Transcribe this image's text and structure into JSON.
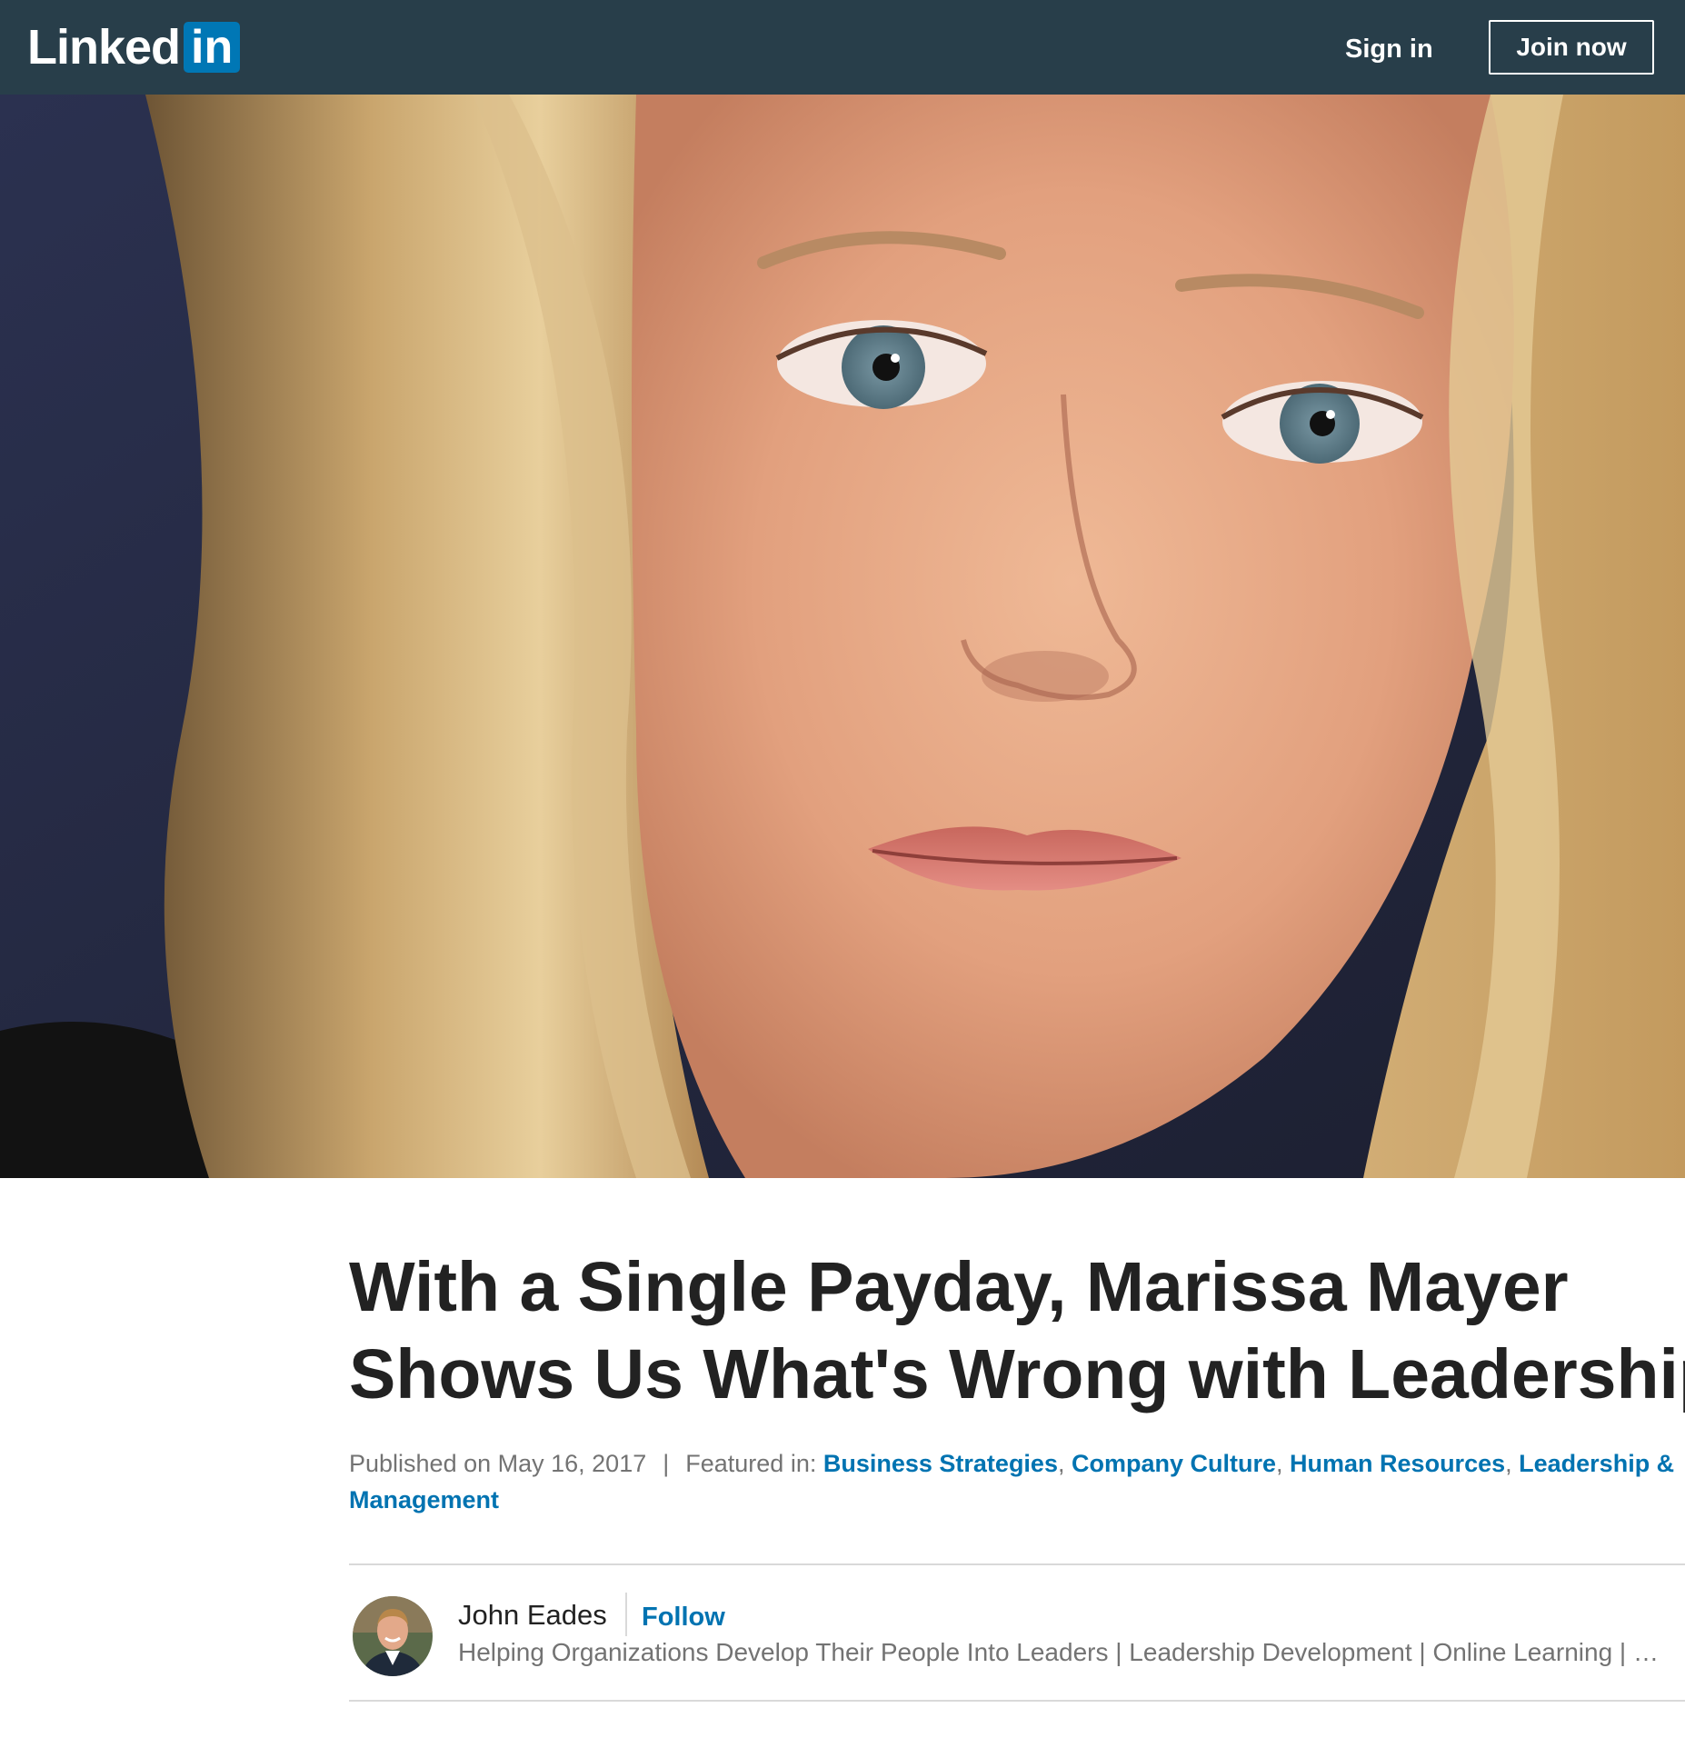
{
  "header": {
    "logo_text": "Linked",
    "logo_box_text": "in",
    "sign_in_label": "Sign in",
    "join_now_label": "Join now",
    "bar_color": "#283e4a",
    "brand_color": "#0077b5"
  },
  "hero": {
    "description_icon": "photo-hero"
  },
  "article": {
    "title_line1": "With a Single Payday, Marissa Mayer",
    "title_line2": "Shows Us What's Wrong with Leadership",
    "published": "Published on May 16, 2017",
    "separator": "|",
    "featured_label": "Featured in:",
    "featured_topics": [
      "Business Strategies",
      "Company Culture",
      "Human Resources",
      "Leadership & Management"
    ],
    "link_color": "#0073b1"
  },
  "author": {
    "name": "John Eades",
    "follow_label": "Follow",
    "headline": "Helping Organizations Develop Their People Into Leaders | Leadership Development | Online Learning | Mi…"
  }
}
